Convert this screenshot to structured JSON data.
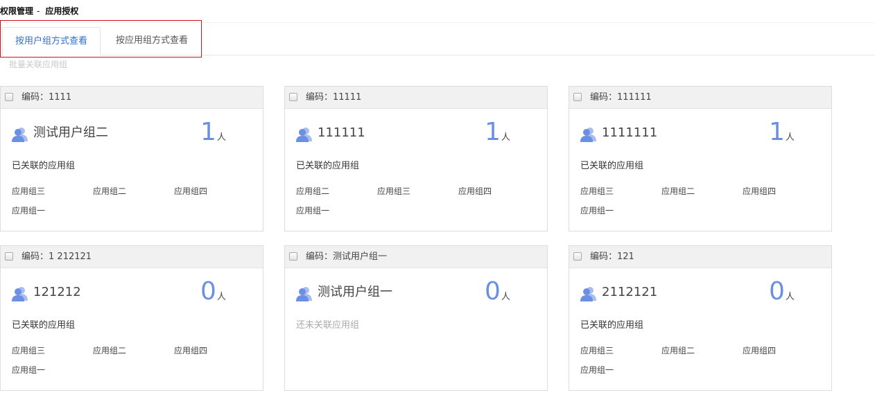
{
  "breadcrumb": {
    "parent": "权限管理",
    "separator": "-",
    "current": "应用授权"
  },
  "tabs": [
    {
      "label": "按用户组方式查看",
      "active": true
    },
    {
      "label": "按应用组方式查看",
      "active": false
    }
  ],
  "batch_link": "批量关联应用组",
  "card_labels": {
    "code_prefix": "编码：",
    "count_unit": "人",
    "assoc_title": "已关联的应用组",
    "assoc_empty": "还未关联应用组"
  },
  "cards": [
    {
      "code": "1111",
      "name": "测试用户组二",
      "count": "1",
      "apps": [
        "应用组三",
        "应用组二",
        "应用组四",
        "应用组一"
      ]
    },
    {
      "code": "11111",
      "name": "111111",
      "count": "1",
      "apps": [
        "应用组二",
        "应用组三",
        "应用组四",
        "应用组一"
      ]
    },
    {
      "code": "111111",
      "name": "1111111",
      "count": "1",
      "apps": [
        "应用组三",
        "应用组二",
        "应用组四",
        "应用组一"
      ]
    },
    {
      "code": "1 212121",
      "name": "121212",
      "count": "0",
      "apps": [
        "应用组三",
        "应用组二",
        "应用组四",
        "应用组一"
      ]
    },
    {
      "code": "测试用户组一",
      "name": "测试用户组一",
      "count": "0",
      "apps": []
    },
    {
      "code": "121",
      "name": "2112121",
      "count": "0",
      "apps": [
        "应用组三",
        "应用组二",
        "应用组四",
        "应用组一"
      ]
    }
  ],
  "colors": {
    "accent": "#2f6fce",
    "count_number": "#6b8fe3",
    "user_icon": "#6b8fe3",
    "tab_highlight_border": "#c9141c"
  },
  "icons": {
    "user_group": "user-group-icon"
  }
}
